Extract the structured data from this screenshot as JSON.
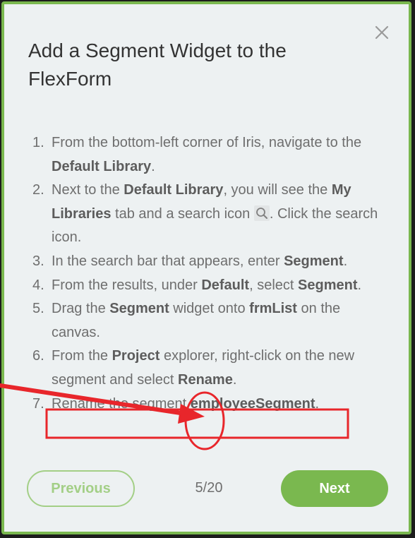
{
  "dialog": {
    "title": "Add a Segment Widget to the FlexForm",
    "steps": [
      {
        "number": "1.",
        "parts": [
          "From the bottom-left corner of Iris, navigate to the ",
          "Default Library",
          "."
        ]
      },
      {
        "number": "2.",
        "parts": [
          "Next to the ",
          "Default Library",
          ", you will see the ",
          "My Libraries",
          " tab and a search icon ",
          ". Click the search icon."
        ]
      },
      {
        "number": "3.",
        "parts": [
          "In the search bar that appears, enter ",
          "Segment",
          "."
        ]
      },
      {
        "number": "4.",
        "parts": [
          "From the results, under ",
          "Default",
          ", select ",
          "Segment",
          "."
        ]
      },
      {
        "number": "5.",
        "parts": [
          "Drag the ",
          "Segment",
          " widget onto ",
          "frmList",
          " on the canvas."
        ]
      },
      {
        "number": "6.",
        "parts": [
          "From the ",
          "Project",
          " explorer, right-click on the new segment and select ",
          "Rename",
          "."
        ]
      },
      {
        "number": "7.",
        "parts": [
          "Rename the segment ",
          "employeeSegment",
          "."
        ]
      }
    ],
    "footer": {
      "previous_label": "Previous",
      "pager": "5/20",
      "next_label": "Next"
    },
    "icons": {
      "close": "close-icon",
      "inline_search": "search-icon"
    }
  },
  "colors": {
    "accent_green": "#7ab84f",
    "light_green": "#a3cf86",
    "panel_background": "#edf1f2",
    "annotation_red": "#e8262b",
    "title_text": "#333333",
    "body_text": "#6e6e6e"
  }
}
